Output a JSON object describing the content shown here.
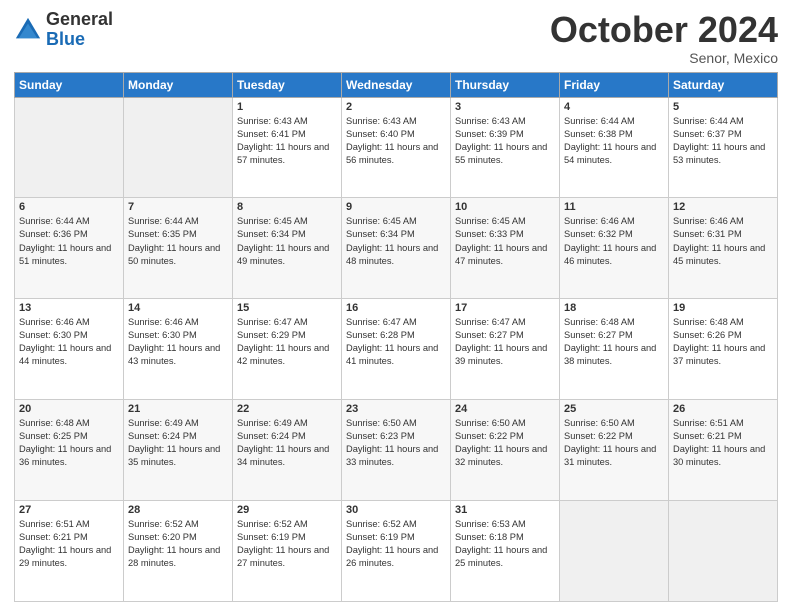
{
  "logo": {
    "general": "General",
    "blue": "Blue"
  },
  "title": "October 2024",
  "location": "Senor, Mexico",
  "days_header": [
    "Sunday",
    "Monday",
    "Tuesday",
    "Wednesday",
    "Thursday",
    "Friday",
    "Saturday"
  ],
  "weeks": [
    [
      {
        "day": "",
        "info": ""
      },
      {
        "day": "",
        "info": ""
      },
      {
        "day": "1",
        "info": "Sunrise: 6:43 AM\nSunset: 6:41 PM\nDaylight: 11 hours and 57 minutes."
      },
      {
        "day": "2",
        "info": "Sunrise: 6:43 AM\nSunset: 6:40 PM\nDaylight: 11 hours and 56 minutes."
      },
      {
        "day": "3",
        "info": "Sunrise: 6:43 AM\nSunset: 6:39 PM\nDaylight: 11 hours and 55 minutes."
      },
      {
        "day": "4",
        "info": "Sunrise: 6:44 AM\nSunset: 6:38 PM\nDaylight: 11 hours and 54 minutes."
      },
      {
        "day": "5",
        "info": "Sunrise: 6:44 AM\nSunset: 6:37 PM\nDaylight: 11 hours and 53 minutes."
      }
    ],
    [
      {
        "day": "6",
        "info": "Sunrise: 6:44 AM\nSunset: 6:36 PM\nDaylight: 11 hours and 51 minutes."
      },
      {
        "day": "7",
        "info": "Sunrise: 6:44 AM\nSunset: 6:35 PM\nDaylight: 11 hours and 50 minutes."
      },
      {
        "day": "8",
        "info": "Sunrise: 6:45 AM\nSunset: 6:34 PM\nDaylight: 11 hours and 49 minutes."
      },
      {
        "day": "9",
        "info": "Sunrise: 6:45 AM\nSunset: 6:34 PM\nDaylight: 11 hours and 48 minutes."
      },
      {
        "day": "10",
        "info": "Sunrise: 6:45 AM\nSunset: 6:33 PM\nDaylight: 11 hours and 47 minutes."
      },
      {
        "day": "11",
        "info": "Sunrise: 6:46 AM\nSunset: 6:32 PM\nDaylight: 11 hours and 46 minutes."
      },
      {
        "day": "12",
        "info": "Sunrise: 6:46 AM\nSunset: 6:31 PM\nDaylight: 11 hours and 45 minutes."
      }
    ],
    [
      {
        "day": "13",
        "info": "Sunrise: 6:46 AM\nSunset: 6:30 PM\nDaylight: 11 hours and 44 minutes."
      },
      {
        "day": "14",
        "info": "Sunrise: 6:46 AM\nSunset: 6:30 PM\nDaylight: 11 hours and 43 minutes."
      },
      {
        "day": "15",
        "info": "Sunrise: 6:47 AM\nSunset: 6:29 PM\nDaylight: 11 hours and 42 minutes."
      },
      {
        "day": "16",
        "info": "Sunrise: 6:47 AM\nSunset: 6:28 PM\nDaylight: 11 hours and 41 minutes."
      },
      {
        "day": "17",
        "info": "Sunrise: 6:47 AM\nSunset: 6:27 PM\nDaylight: 11 hours and 39 minutes."
      },
      {
        "day": "18",
        "info": "Sunrise: 6:48 AM\nSunset: 6:27 PM\nDaylight: 11 hours and 38 minutes."
      },
      {
        "day": "19",
        "info": "Sunrise: 6:48 AM\nSunset: 6:26 PM\nDaylight: 11 hours and 37 minutes."
      }
    ],
    [
      {
        "day": "20",
        "info": "Sunrise: 6:48 AM\nSunset: 6:25 PM\nDaylight: 11 hours and 36 minutes."
      },
      {
        "day": "21",
        "info": "Sunrise: 6:49 AM\nSunset: 6:24 PM\nDaylight: 11 hours and 35 minutes."
      },
      {
        "day": "22",
        "info": "Sunrise: 6:49 AM\nSunset: 6:24 PM\nDaylight: 11 hours and 34 minutes."
      },
      {
        "day": "23",
        "info": "Sunrise: 6:50 AM\nSunset: 6:23 PM\nDaylight: 11 hours and 33 minutes."
      },
      {
        "day": "24",
        "info": "Sunrise: 6:50 AM\nSunset: 6:22 PM\nDaylight: 11 hours and 32 minutes."
      },
      {
        "day": "25",
        "info": "Sunrise: 6:50 AM\nSunset: 6:22 PM\nDaylight: 11 hours and 31 minutes."
      },
      {
        "day": "26",
        "info": "Sunrise: 6:51 AM\nSunset: 6:21 PM\nDaylight: 11 hours and 30 minutes."
      }
    ],
    [
      {
        "day": "27",
        "info": "Sunrise: 6:51 AM\nSunset: 6:21 PM\nDaylight: 11 hours and 29 minutes."
      },
      {
        "day": "28",
        "info": "Sunrise: 6:52 AM\nSunset: 6:20 PM\nDaylight: 11 hours and 28 minutes."
      },
      {
        "day": "29",
        "info": "Sunrise: 6:52 AM\nSunset: 6:19 PM\nDaylight: 11 hours and 27 minutes."
      },
      {
        "day": "30",
        "info": "Sunrise: 6:52 AM\nSunset: 6:19 PM\nDaylight: 11 hours and 26 minutes."
      },
      {
        "day": "31",
        "info": "Sunrise: 6:53 AM\nSunset: 6:18 PM\nDaylight: 11 hours and 25 minutes."
      },
      {
        "day": "",
        "info": ""
      },
      {
        "day": "",
        "info": ""
      }
    ]
  ]
}
